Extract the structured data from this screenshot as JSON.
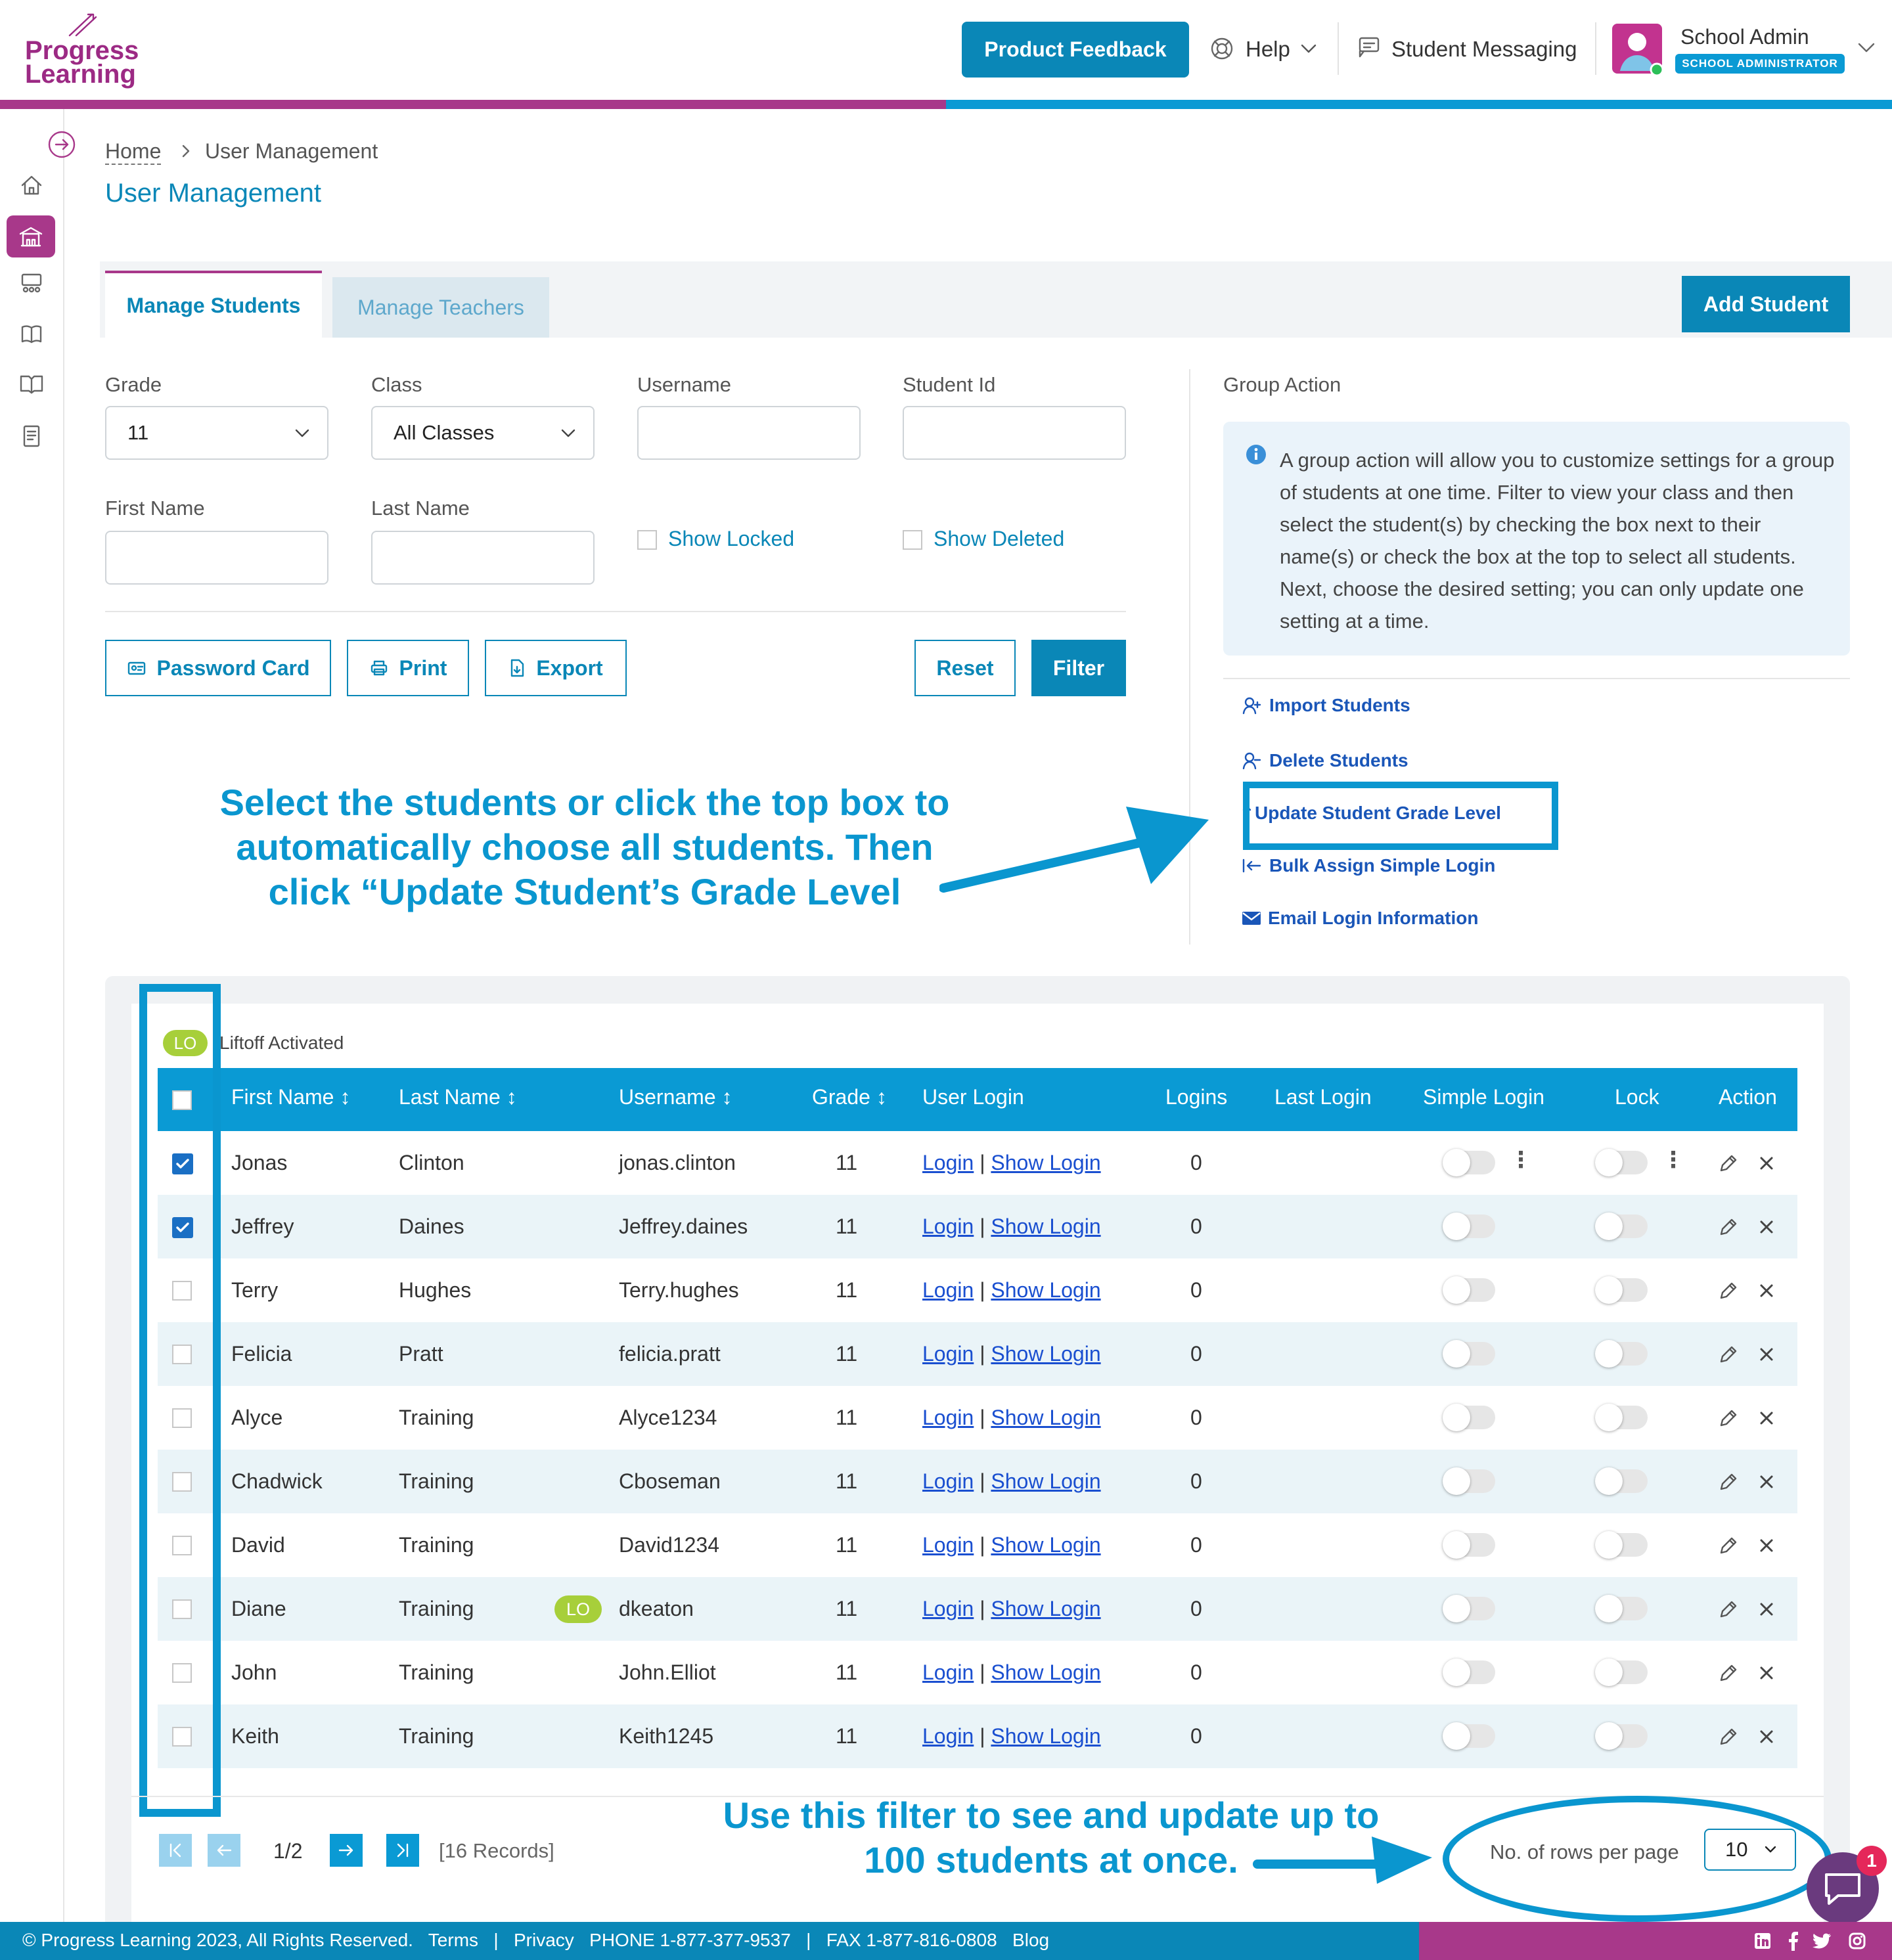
{
  "brand": {
    "line1": "Progress",
    "line2": "Learning"
  },
  "header": {
    "feedback_label": "Product Feedback",
    "help_label": "Help",
    "messaging_label": "Student Messaging",
    "user_name": "School Admin",
    "user_role": "SCHOOL ADMINISTRATOR"
  },
  "breadcrumb": {
    "home": "Home",
    "current": "User Management"
  },
  "page_title": "User Management",
  "tabs": {
    "students": "Manage Students",
    "teachers": "Manage Teachers"
  },
  "add_student_label": "Add Student",
  "filters": {
    "grade_label": "Grade",
    "grade_value": "11",
    "class_label": "Class",
    "class_value": "All Classes",
    "username_label": "Username",
    "studentid_label": "Student Id",
    "firstname_label": "First Name",
    "lastname_label": "Last Name",
    "show_locked": "Show Locked",
    "show_deleted": "Show Deleted"
  },
  "buttons": {
    "password_card": "Password Card",
    "print": "Print",
    "export": "Export",
    "reset": "Reset",
    "filter": "Filter"
  },
  "group_action": {
    "title": "Group Action",
    "info": "A group action will allow you to customize settings for a group of students at one time. Filter to view your class and then select the student(s) by checking the box next to their name(s) or check the box at the top to select all students. Next, choose the desired setting; you can only update one setting at a time.",
    "import": "Import Students",
    "delete": "Delete Students",
    "update_grade": "Update Student Grade Level",
    "bulk_simple": "Bulk Assign Simple Login",
    "email_login": "Email Login Information"
  },
  "annotations": {
    "select_line1": "Select the students or click the top box to",
    "select_line2": "automatically choose all students. Then",
    "select_line3": "click “Update Student’s Grade Level",
    "rows_line1": "Use this filter to see and update up to",
    "rows_line2": "100 students at once."
  },
  "legend": {
    "badge": "LO",
    "label": "Liftoff Activated"
  },
  "table": {
    "headers": {
      "first": "First Name",
      "last": "Last Name",
      "username": "Username",
      "grade": "Grade",
      "user_login": "User Login",
      "logins": "Logins",
      "last_login": "Last Login",
      "simple_login": "Simple Login",
      "lock": "Lock",
      "action": "Action"
    },
    "login_link": "Login",
    "sep": "|",
    "show_login_link": "Show Login",
    "rows": [
      {
        "first": "Jonas",
        "last": "Clinton",
        "username": "jonas.clinton",
        "grade": "11",
        "logins": "0"
      },
      {
        "first": "Jeffrey",
        "last": "Daines",
        "username": "Jeffrey.daines",
        "grade": "11",
        "logins": "0"
      },
      {
        "first": "Terry",
        "last": "Hughes",
        "username": "Terry.hughes",
        "grade": "11",
        "logins": "0"
      },
      {
        "first": "Felicia",
        "last": "Pratt",
        "username": "felicia.pratt",
        "grade": "11",
        "logins": "0"
      },
      {
        "first": "Alyce",
        "last": "Training",
        "username": "Alyce1234",
        "grade": "11",
        "logins": "0"
      },
      {
        "first": "Chadwick",
        "last": "Training",
        "username": "Cboseman",
        "grade": "11",
        "logins": "0"
      },
      {
        "first": "David",
        "last": "Training",
        "username": "David1234",
        "grade": "11",
        "logins": "0"
      },
      {
        "first": "Diane",
        "last": "Training",
        "username": "dkeaton",
        "grade": "11",
        "logins": "0",
        "badge": "LO"
      },
      {
        "first": "John",
        "last": "Training",
        "username": "John.Elliot",
        "grade": "11",
        "logins": "0"
      },
      {
        "first": "Keith",
        "last": "Training",
        "username": "Keith1245",
        "grade": "11",
        "logins": "0"
      }
    ]
  },
  "pagination": {
    "page": "1/2",
    "records": "[16 Records]",
    "rows_label": "No. of rows per page",
    "rows_value": "10"
  },
  "chat_badge": "1",
  "footer": {
    "copyright": "© Progress Learning 2023, All Rights Reserved.",
    "terms": "Terms",
    "sep": "|",
    "privacy": "Privacy",
    "phone": "PHONE 1-877-377-9537",
    "fax": "FAX 1-877-816-0808",
    "blog": "Blog"
  },
  "colors": {
    "primary": "#0a87b7",
    "accent": "#0a9ad4",
    "brand": "#a8388a",
    "link": "#1a4fd0",
    "annotation": "#0a96cf"
  },
  "icons": [
    "logo-mark-icon",
    "help-lifebuoy-icon",
    "chevron-down-icon",
    "chat-icon",
    "avatar",
    "expand-arrow-icon",
    "home-icon",
    "school-icon",
    "classroom-icon",
    "book-icon",
    "library-icon",
    "report-icon",
    "info-icon",
    "user-plus-icon",
    "user-minus-icon",
    "arrow-up-icon",
    "arrow-left-bar-icon",
    "envelope-icon",
    "pencil-icon",
    "close-icon",
    "first-page-icon",
    "prev-page-icon",
    "next-page-icon",
    "last-page-icon",
    "linkedin-icon",
    "facebook-icon",
    "twitter-icon",
    "instagram-icon"
  ]
}
